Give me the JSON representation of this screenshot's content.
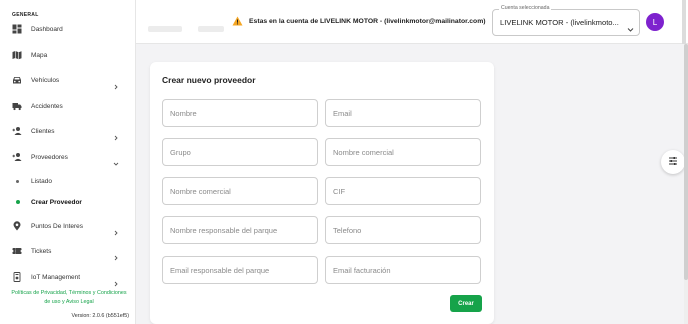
{
  "colors": {
    "accent": "#16a34a",
    "avatar_bg": "#7e22ce",
    "warning": "#f5a623"
  },
  "sidebar": {
    "section_label": "GENERAL",
    "items": [
      {
        "label": "Dashboard",
        "icon": "dashboard-icon"
      },
      {
        "label": "Mapa",
        "icon": "map-icon"
      },
      {
        "label": "Vehículos",
        "icon": "car-icon",
        "chevron": "right"
      },
      {
        "label": "Accidentes",
        "icon": "truck-icon"
      },
      {
        "label": "Clientes",
        "icon": "user-add-icon",
        "chevron": "right"
      },
      {
        "label": "Proveedores",
        "icon": "user-add-icon",
        "chevron": "down"
      },
      {
        "label": "Listado"
      },
      {
        "label": "Crear Proveedor",
        "active": true
      },
      {
        "label": "Puntos De Interes",
        "icon": "location-icon",
        "chevron": "right"
      },
      {
        "label": "Tickets",
        "icon": "ticket-icon",
        "chevron": "right"
      },
      {
        "label": "IoT Management",
        "icon": "device-icon",
        "chevron": "right"
      }
    ],
    "footer_line1": "Políticas de Privacidad, Términos y Condiciones",
    "footer_line2": "de uso y Aviso Legal",
    "version": "Version: 2.0.6 (b551ef5)"
  },
  "header": {
    "warning_text": "Estas en la cuenta de LIVELINK MOTOR - (livelinkmotor@mailinator.com)",
    "account_label": "Cuenta seleccionada",
    "account_value": "LIVELINK MOTOR - (livelinkmoto...",
    "avatar_letter": "L"
  },
  "form": {
    "title": "Crear nuevo proveedor",
    "fields": [
      {
        "placeholder": "Nombre"
      },
      {
        "placeholder": "Email"
      },
      {
        "placeholder": "Grupo"
      },
      {
        "placeholder": "Nombre comercial"
      },
      {
        "placeholder": "Nombre comercial"
      },
      {
        "placeholder": "CIF"
      },
      {
        "placeholder": "Nombre responsable del parque"
      },
      {
        "placeholder": "Telefono"
      },
      {
        "placeholder": "Email responsable del parque"
      },
      {
        "placeholder": "Email facturación"
      }
    ],
    "submit_label": "Crear"
  }
}
